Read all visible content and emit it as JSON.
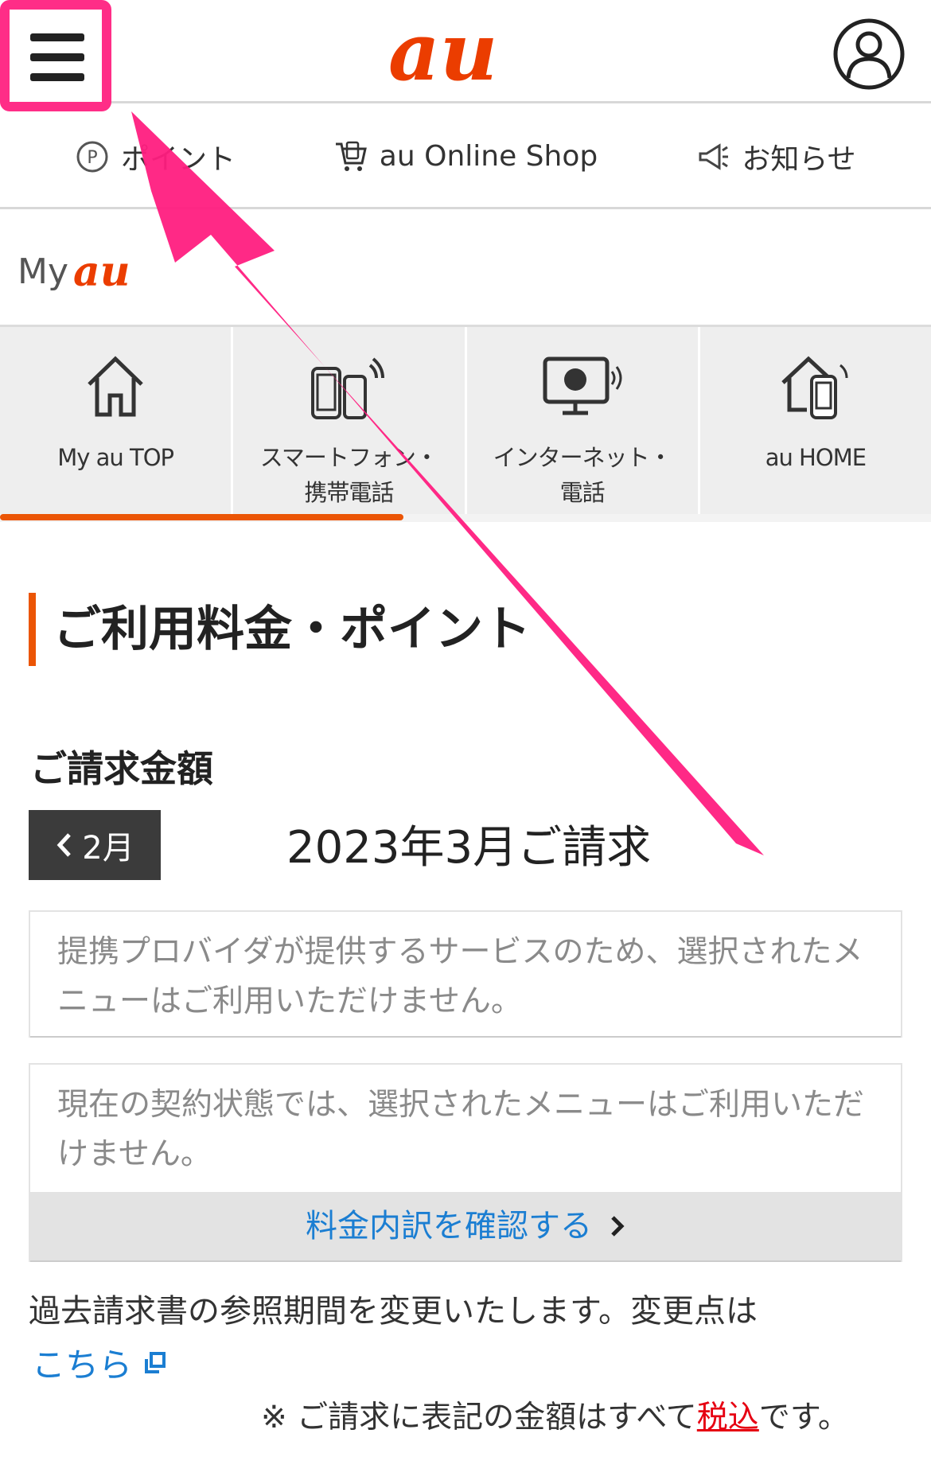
{
  "header": {
    "menu_icon": "hamburger-menu-icon",
    "logo_icon": "au-logo",
    "user_icon": "user-account-icon"
  },
  "subnav": {
    "items": [
      {
        "label": "ポイント",
        "icon": "point-icon"
      },
      {
        "label": "au Online Shop",
        "icon": "shopping-cart-icon"
      },
      {
        "label": "お知らせ",
        "icon": "megaphone-icon"
      }
    ]
  },
  "myau": {
    "prefix": "My"
  },
  "tabs": [
    {
      "label": "My au TOP",
      "icon": "home-icon"
    },
    {
      "label": "スマートフォン・\n携帯電話",
      "icon": "smartphone-icon"
    },
    {
      "label": "インターネット・\n電話",
      "icon": "internet-tv-icon"
    },
    {
      "label": "au HOME",
      "icon": "au-home-icon"
    }
  ],
  "section": {
    "title": "ご利用料金・ポイント"
  },
  "billing": {
    "subtitle": "ご請求金額",
    "prev_label": "2月",
    "current_month": "2023年3月ご請求"
  },
  "notices": {
    "first": "提携プロバイダが提供するサービスのため、選択されたメニューはご利用いただけません。",
    "second": "現在の契約状態では、選択されたメニューはご利用いただけません。",
    "detail_link": "料金内訳を確認する"
  },
  "footer": {
    "past_text": "過去請求書の参照期間を変更いたします。変更点は",
    "kochira": "こちら",
    "footnote_prefix": "※ ご請求に表記の金額はすべて",
    "footnote_red": "税込",
    "footnote_suffix": "です。"
  },
  "colors": {
    "accent": "#eb5505",
    "link": "#1b7ed2",
    "highlight": "#ff2d87"
  }
}
